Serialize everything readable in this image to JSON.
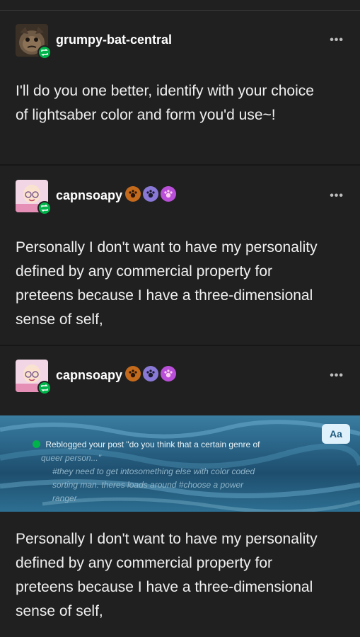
{
  "posts": [
    {
      "username": "grumpy-bat-central",
      "more": "•••",
      "text": "I'll do you one better, identify with your choice of lightsaber color and form you'd use~!"
    },
    {
      "username": "capnsoapy",
      "more": "•••",
      "text": "Personally I  don't want to have my personality defined by any commercial property for preteens because I have a three-dimensional sense of self,"
    },
    {
      "username": "capnsoapy",
      "more": "•••",
      "quote": {
        "line1": "Reblogged your post \"do you think that a certain genre of",
        "line2": "queer person...\"",
        "line3": "#they need to get intosomething else with color coded",
        "line4": "sorting man. theres loads around #choose a power",
        "line5": "ranger",
        "aa": "Aa"
      },
      "text": "Personally I  don't want to have my personality defined by any commercial property for preteens because I have a three-dimensional sense of self,"
    }
  ],
  "colors": {
    "reblog": "#00b34a",
    "background": "#202020"
  }
}
